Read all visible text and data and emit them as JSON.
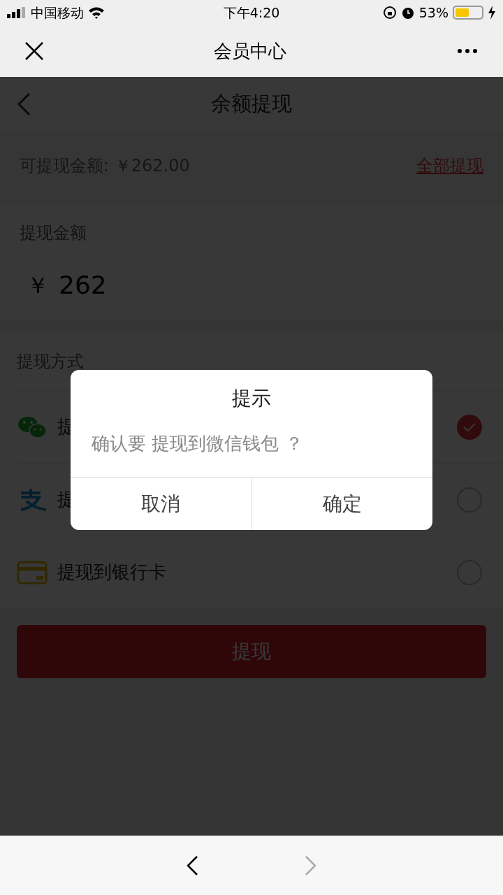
{
  "status_bar": {
    "carrier": "中国移动",
    "time": "下午4:20",
    "battery": "53%"
  },
  "nav_bar": {
    "title": "会员中心"
  },
  "page_header": {
    "title": "余额提现"
  },
  "available": {
    "label": "可提现金额: ￥262.00",
    "action": "全部提现"
  },
  "amount": {
    "label": "提现金额",
    "currency": "￥",
    "value": "262"
  },
  "methods": {
    "title": "提现方式",
    "items": [
      {
        "kind": "wechat",
        "label": "提",
        "selected": true
      },
      {
        "kind": "alipay",
        "label": "提",
        "selected": false
      },
      {
        "kind": "bank",
        "label": "提现到银行卡",
        "selected": false
      }
    ]
  },
  "submit": "提现",
  "dialog": {
    "title": "提示",
    "message": "确认要 提现到微信钱包 ？",
    "buttons": [
      "取消",
      "确定"
    ]
  }
}
